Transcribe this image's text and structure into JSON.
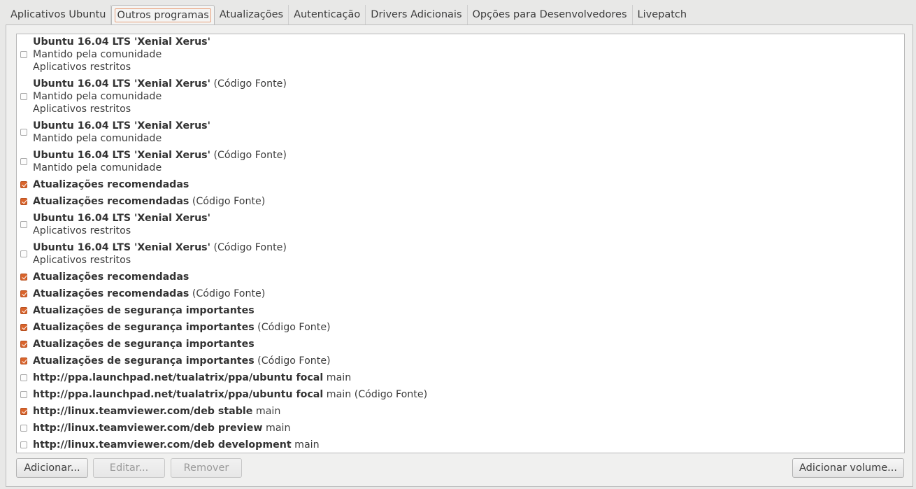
{
  "tabs": [
    {
      "label": "Aplicativos Ubuntu",
      "active": false
    },
    {
      "label": "Outros programas",
      "active": true
    },
    {
      "label": "Atualizações",
      "active": false
    },
    {
      "label": "Autenticação",
      "active": false
    },
    {
      "label": "Drivers Adicionais",
      "active": false
    },
    {
      "label": "Opções para Desenvolvedores",
      "active": false
    },
    {
      "label": "Livepatch",
      "active": false
    }
  ],
  "sources": [
    {
      "checked": false,
      "title": "Ubuntu 16.04 LTS 'Xenial Xerus'",
      "suffix": "",
      "details": [
        "Mantido pela comunidade",
        "Aplicativos restritos"
      ]
    },
    {
      "checked": false,
      "title": "Ubuntu 16.04 LTS 'Xenial Xerus'",
      "suffix": "(Código Fonte)",
      "details": [
        "Mantido pela comunidade",
        "Aplicativos restritos"
      ]
    },
    {
      "checked": false,
      "title": "Ubuntu 16.04 LTS 'Xenial Xerus'",
      "suffix": "",
      "details": [
        "Mantido pela comunidade"
      ]
    },
    {
      "checked": false,
      "title": "Ubuntu 16.04 LTS 'Xenial Xerus'",
      "suffix": "(Código Fonte)",
      "details": [
        "Mantido pela comunidade"
      ]
    },
    {
      "checked": true,
      "title": "Atualizações recomendadas",
      "suffix": "",
      "details": []
    },
    {
      "checked": true,
      "title": "Atualizações recomendadas",
      "suffix": "(Código Fonte)",
      "details": []
    },
    {
      "checked": false,
      "title": "Ubuntu 16.04 LTS 'Xenial Xerus'",
      "suffix": "",
      "details": [
        "Aplicativos restritos"
      ]
    },
    {
      "checked": false,
      "title": "Ubuntu 16.04 LTS 'Xenial Xerus'",
      "suffix": "(Código Fonte)",
      "details": [
        "Aplicativos restritos"
      ]
    },
    {
      "checked": true,
      "title": "Atualizações recomendadas",
      "suffix": "",
      "details": []
    },
    {
      "checked": true,
      "title": "Atualizações recomendadas",
      "suffix": "(Código Fonte)",
      "details": []
    },
    {
      "checked": true,
      "title": "Atualizações de segurança importantes",
      "suffix": "",
      "details": []
    },
    {
      "checked": true,
      "title": "Atualizações de segurança importantes",
      "suffix": "(Código Fonte)",
      "details": []
    },
    {
      "checked": true,
      "title": "Atualizações de segurança importantes",
      "suffix": "",
      "details": []
    },
    {
      "checked": true,
      "title": "Atualizações de segurança importantes",
      "suffix": "(Código Fonte)",
      "details": []
    },
    {
      "checked": false,
      "title": "http://ppa.launchpad.net/tualatrix/ppa/ubuntu focal",
      "suffix": "main",
      "details": []
    },
    {
      "checked": false,
      "title": "http://ppa.launchpad.net/tualatrix/ppa/ubuntu focal",
      "suffix": "main (Código Fonte)",
      "details": []
    },
    {
      "checked": true,
      "title": "http://linux.teamviewer.com/deb stable",
      "suffix": "main",
      "details": []
    },
    {
      "checked": false,
      "title": "http://linux.teamviewer.com/deb preview",
      "suffix": "main",
      "details": []
    },
    {
      "checked": false,
      "title": "http://linux.teamviewer.com/deb development",
      "suffix": "main",
      "details": []
    }
  ],
  "buttons": {
    "add": "Adicionar...",
    "edit": "Editar...",
    "remove": "Remover",
    "add_volume": "Adicionar volume..."
  }
}
